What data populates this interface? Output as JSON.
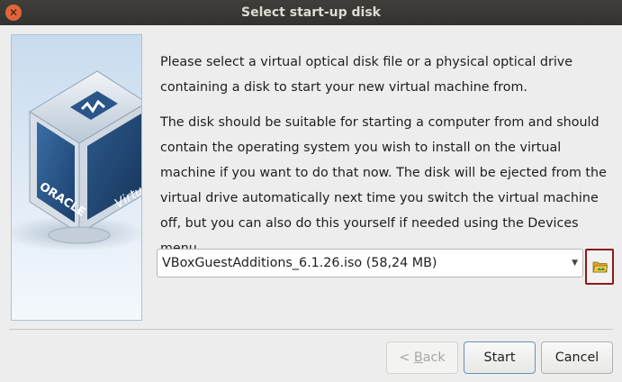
{
  "window": {
    "title": "Select start-up disk",
    "close_icon": "close-icon"
  },
  "banner": {
    "image": "virtualbox-logo-cube",
    "brand_text": "ORACLE",
    "product_text": "Virtu"
  },
  "text": {
    "paragraph1": "Please select a virtual optical disk file or a physical optical drive containing a disk to start your new virtual machine from.",
    "paragraph2": "The disk should be suitable for starting a computer from and should contain the operating system you wish to install on the virtual machine if you want to do that now. The disk will be ejected from the virtual drive automatically next time you switch the virtual machine off, but you can also do this yourself if needed using the Devices menu."
  },
  "disk_select": {
    "selected": "VBoxGuestAdditions_6.1.26.iso (58,24 MB)",
    "arrow_icon": "dropdown-arrow-icon"
  },
  "folder_button": {
    "icon": "folder-open-icon"
  },
  "buttons": {
    "back_mnemonic": "B",
    "back_rest": "ack",
    "back_prefix": "< ",
    "start": "Start",
    "cancel": "Cancel"
  },
  "colors": {
    "titlebar": "#3c3b37",
    "close": "#e0653c",
    "highlight_border": "#8b1a1a"
  }
}
